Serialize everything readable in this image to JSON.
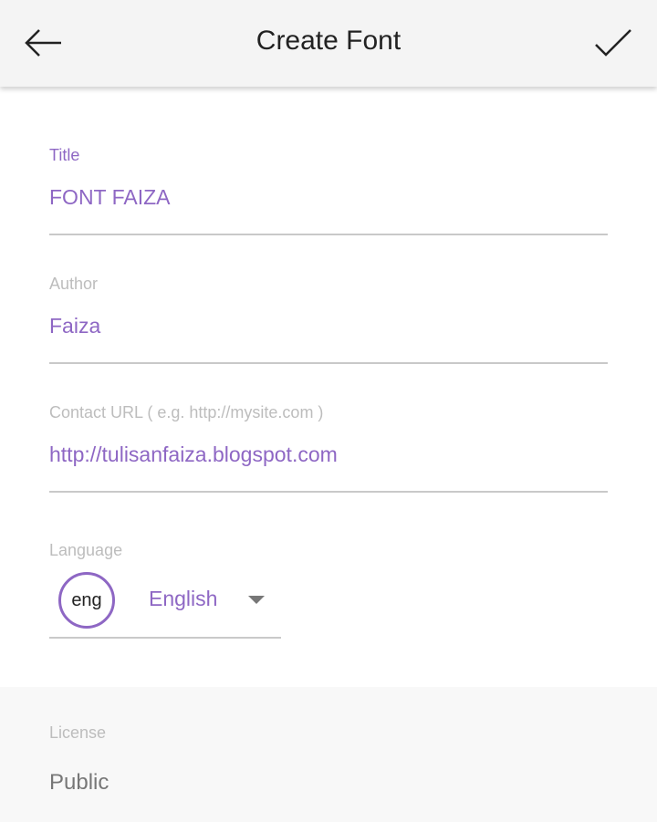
{
  "header": {
    "title": "Create Font",
    "back_icon": "arrow-left-icon",
    "confirm_icon": "check-icon",
    "background": "#f4f4f4"
  },
  "form": {
    "title_field": {
      "label": "Title",
      "value": "FONT FAIZA"
    },
    "author_field": {
      "label": "Author",
      "value": "Faiza"
    },
    "contact_field": {
      "label": "Contact URL ( e.g. http://mysite.com )",
      "value": "http://tulisanfaiza.blogspot.com"
    },
    "language_field": {
      "label": "Language",
      "code": "eng",
      "name": "English",
      "dropdown_icon": "caret-down-icon"
    }
  },
  "license": {
    "label": "License",
    "value": "Public"
  },
  "colors": {
    "accent": "#8e67c4",
    "inactive_label": "#bdbdbd",
    "underline": "#c9c9c9"
  }
}
